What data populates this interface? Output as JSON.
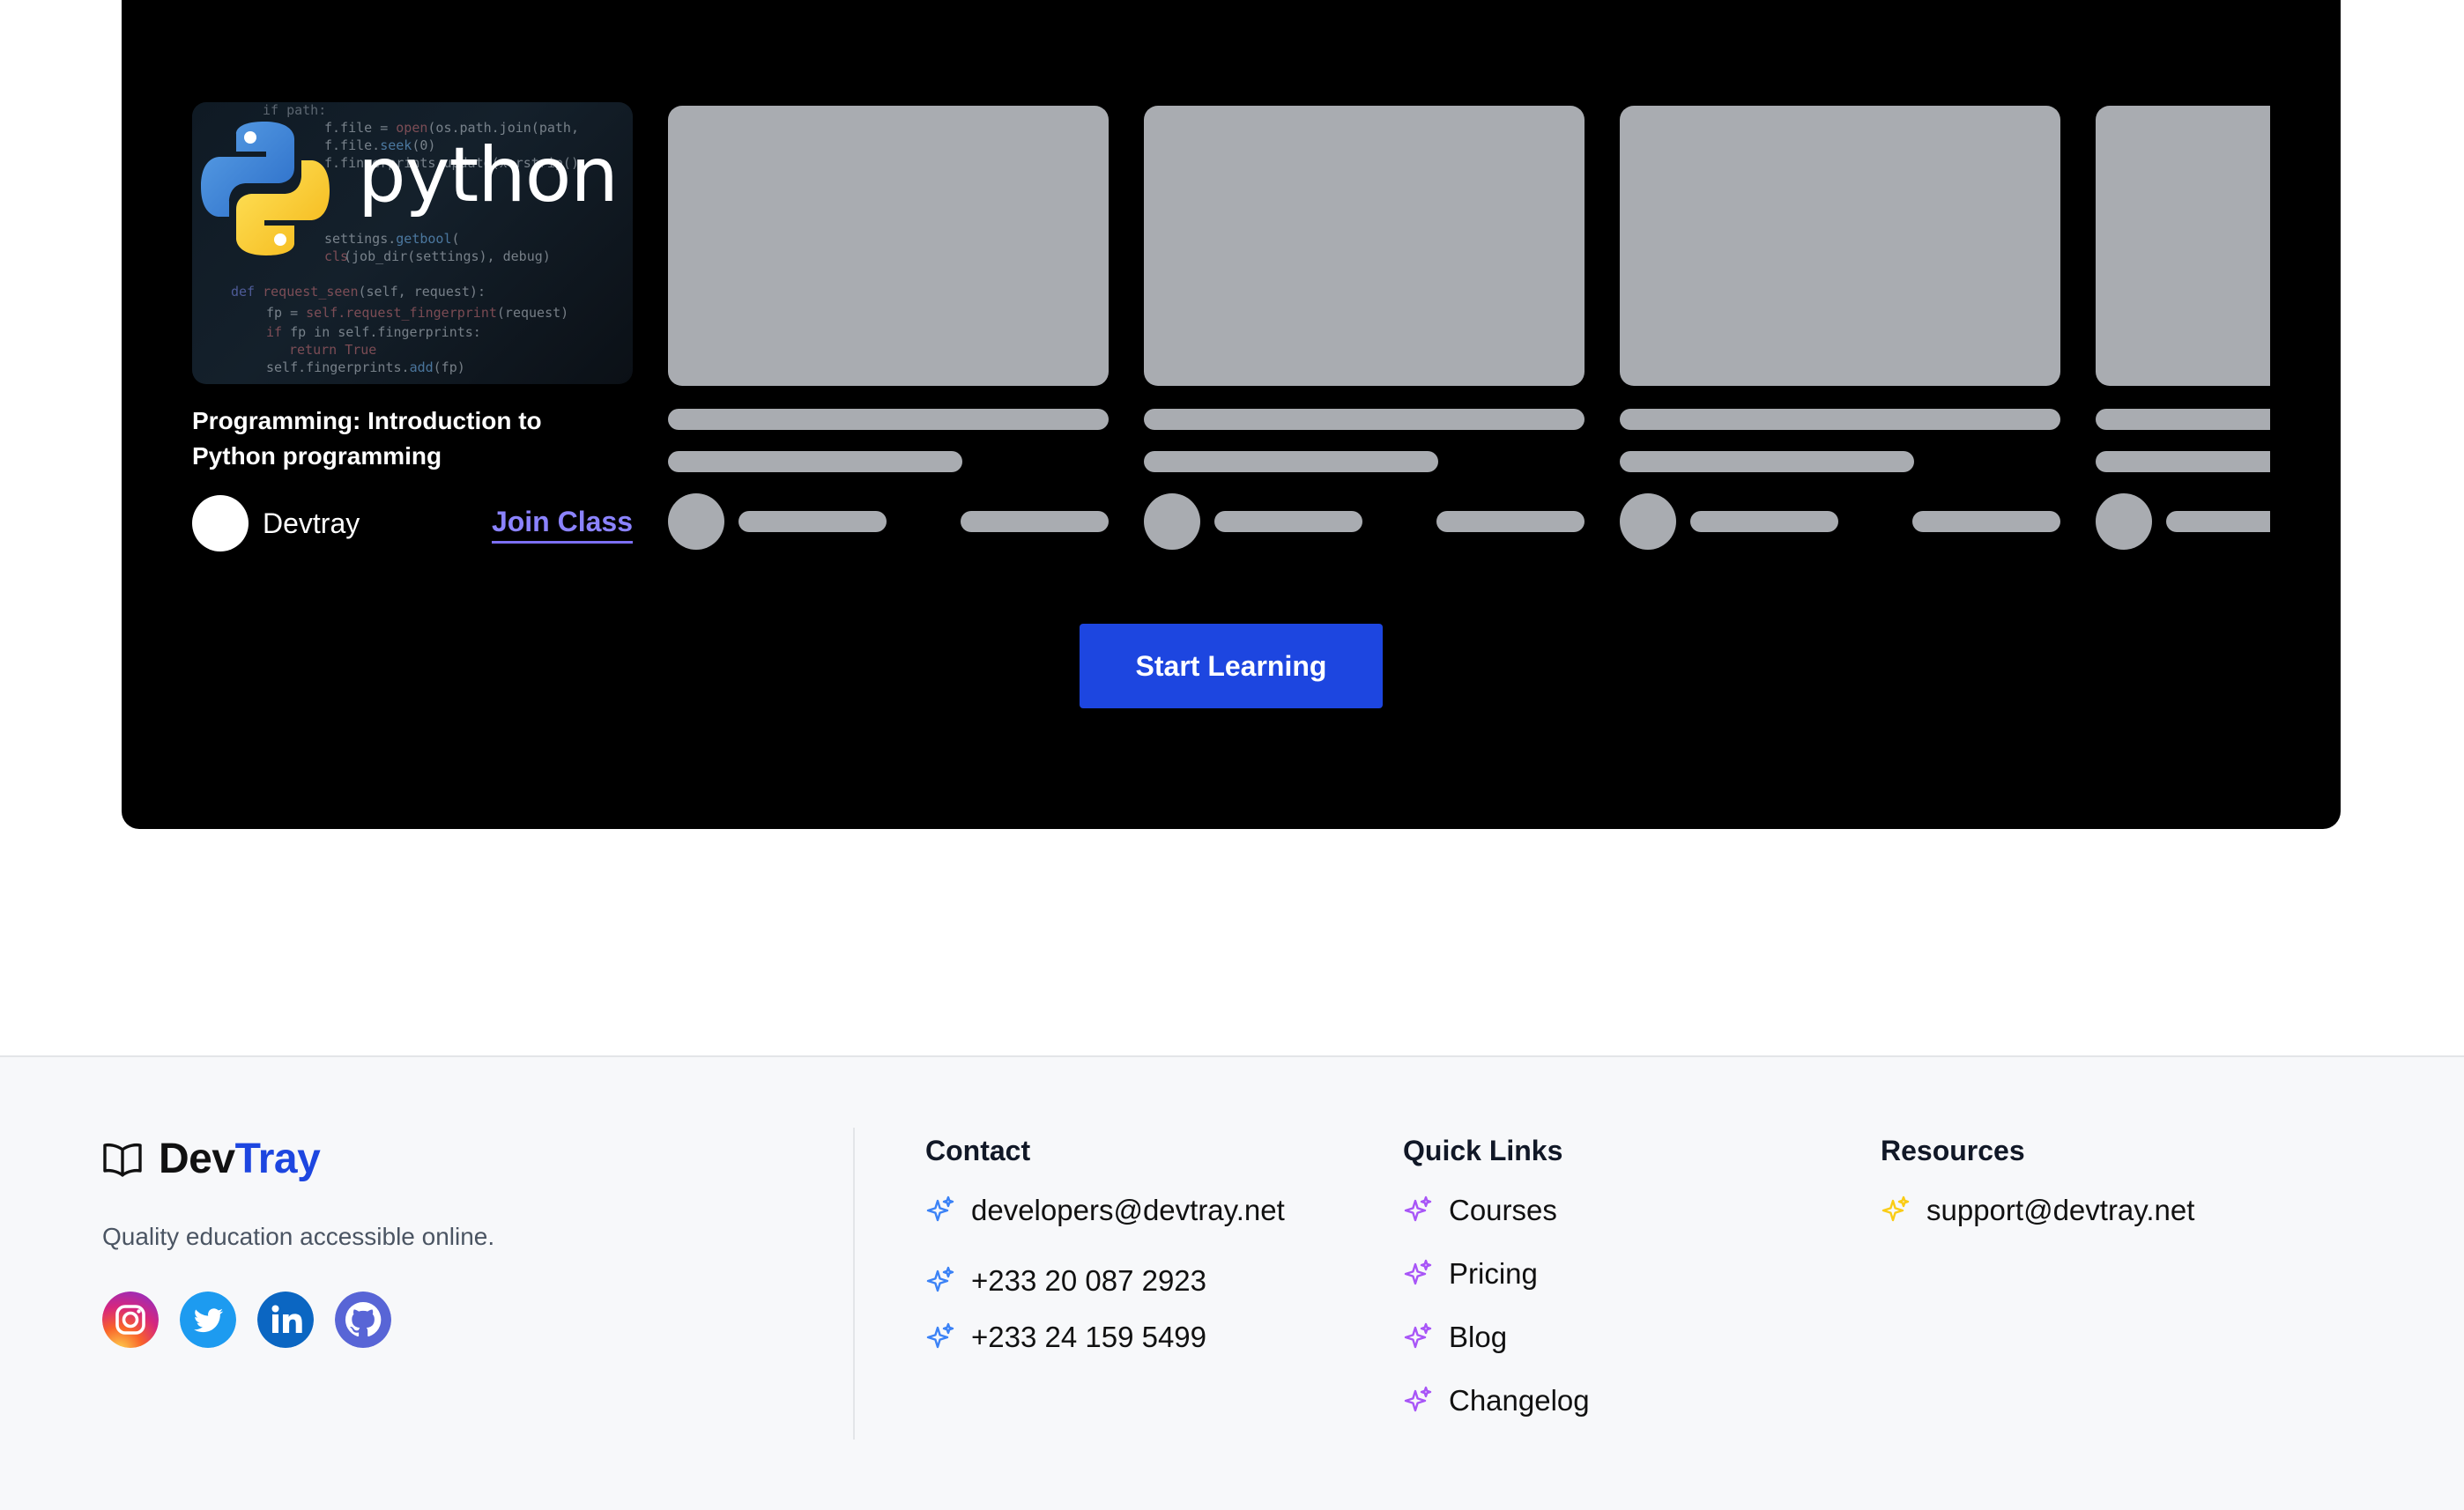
{
  "featured_course": {
    "title": "Programming: Introduction to Python programming",
    "logo_text": "python",
    "author": "Devtray",
    "join_label": "Join Class"
  },
  "cta": {
    "label": "Start Learning"
  },
  "footer": {
    "brand": {
      "name_part1": "Dev",
      "name_part2": "Tray",
      "icon": "book-open-icon"
    },
    "tagline": "Quality education accessible online.",
    "socials": [
      "instagram",
      "twitter",
      "linkedin",
      "github"
    ],
    "contact": {
      "heading": "Contact",
      "items": [
        "developers@devtray.net",
        "+233 20 087 2923",
        "+233 24 159 5499"
      ]
    },
    "quick_links": {
      "heading": "Quick Links",
      "items": [
        "Courses",
        "Pricing",
        "Blog",
        "Changelog"
      ]
    },
    "resources": {
      "heading": "Resources",
      "items": [
        "support@devtray.net"
      ]
    }
  },
  "colors": {
    "accent": "#1d46e0",
    "link": "#8b83ff",
    "skeleton": "#a9acb1",
    "panel": "#000000",
    "contact_sparkle": "#3b82f6",
    "links_sparkle": "#a855f7",
    "resources_sparkle": "#facc15"
  }
}
